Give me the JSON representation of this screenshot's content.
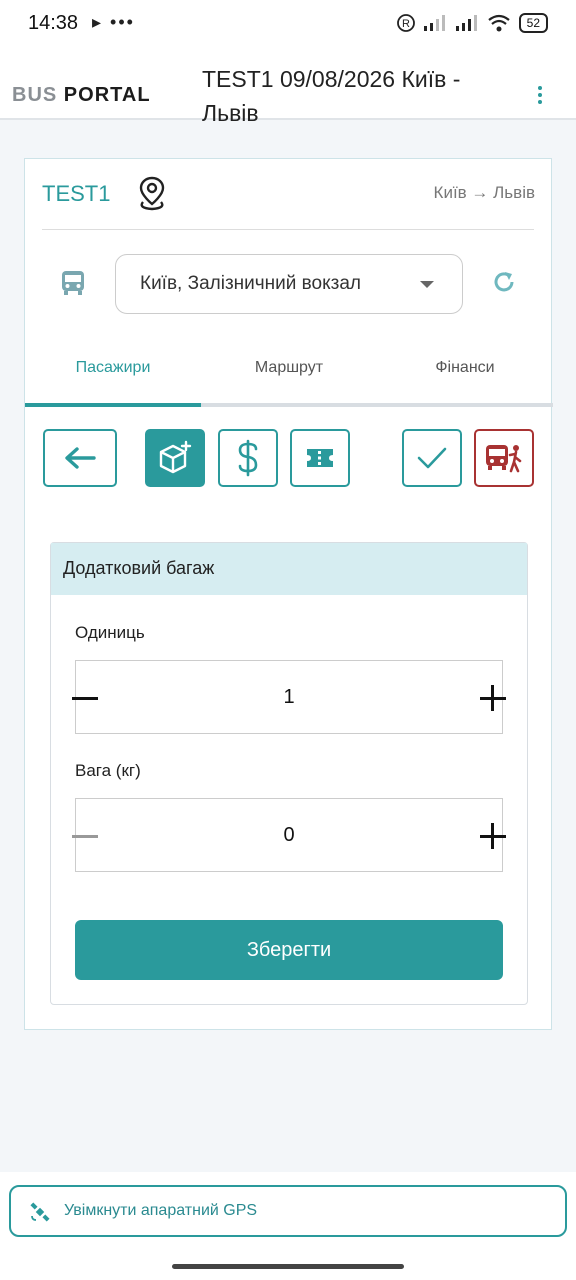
{
  "status_bar": {
    "time": "14:38",
    "left_icons": "▸ •••",
    "battery": "52"
  },
  "header": {
    "logo_bus": "BUS",
    "logo_portal": "PORTAL",
    "title": "TEST1 09/08/2026 Київ - Львів",
    "menu_icon": "more-vertical-icon"
  },
  "trip": {
    "code": "TEST1",
    "route": "Київ → Львів"
  },
  "stop_select": {
    "value": "Київ, Залізничний вокзал"
  },
  "tabs": [
    {
      "label": "Пасажири",
      "active": true
    },
    {
      "label": "Маршрут",
      "active": false
    },
    {
      "label": "Фінанси",
      "active": false
    }
  ],
  "toolbar": {
    "icons": [
      "arrow-left-icon",
      "box-plus-icon",
      "dollar-icon",
      "ticket-icon",
      "check-icon",
      "bus-person-icon"
    ]
  },
  "baggage": {
    "title": "Додатковий багаж",
    "units_label": "Одиниць",
    "units_value": "1",
    "weight_label": "Вага (кг)",
    "weight_value": "0",
    "save_label": "Зберегти"
  },
  "gps": {
    "label": "Увімкнути апаратний GPS"
  },
  "colors": {
    "accent": "#2a9a9c",
    "danger": "#a83232",
    "panel_header": "#d6edf1"
  }
}
